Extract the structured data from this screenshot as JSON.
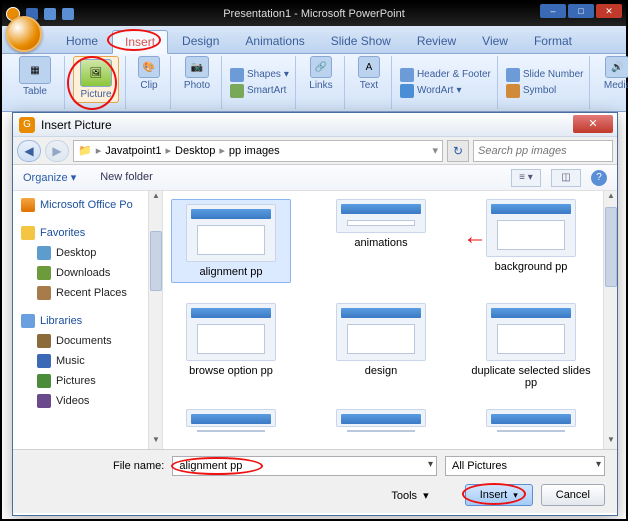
{
  "titlebar": {
    "document": "Presentation1",
    "app": "Microsoft PowerPoint"
  },
  "tabs": [
    "Home",
    "Insert",
    "Design",
    "Animations",
    "Slide Show",
    "Review",
    "View",
    "Format"
  ],
  "active_tab": "Insert",
  "ribbon": {
    "table": "Table",
    "picture": "Picture",
    "clip": "Clip",
    "photo": "Photo",
    "shapes": "Shapes",
    "smartart": "SmartArt",
    "links": "Links",
    "text": "Text",
    "header_footer": "Header & Footer",
    "wordart": "WordArt",
    "slide_number": "Slide Number",
    "symbol": "Symbol",
    "media": "Media"
  },
  "dialog": {
    "title": "Insert Picture",
    "breadcrumb": [
      "Javatpoint1",
      "Desktop",
      "pp images"
    ],
    "search_placeholder": "Search pp images",
    "organize": "Organize",
    "new_folder": "New folder",
    "nav": {
      "office": "Microsoft Office Po",
      "favorites": "Favorites",
      "desktop": "Desktop",
      "downloads": "Downloads",
      "recent": "Recent Places",
      "libraries": "Libraries",
      "documents": "Documents",
      "music": "Music",
      "pictures": "Pictures",
      "videos": "Videos"
    },
    "files": [
      "alignment pp",
      "animations",
      "background pp",
      "browse option pp",
      "design",
      "duplicate selected slides pp"
    ],
    "selected": "alignment pp",
    "file_name_label": "File name:",
    "file_name_value": "alignment pp",
    "filter": "All Pictures",
    "tools": "Tools",
    "insert": "Insert",
    "cancel": "Cancel"
  }
}
